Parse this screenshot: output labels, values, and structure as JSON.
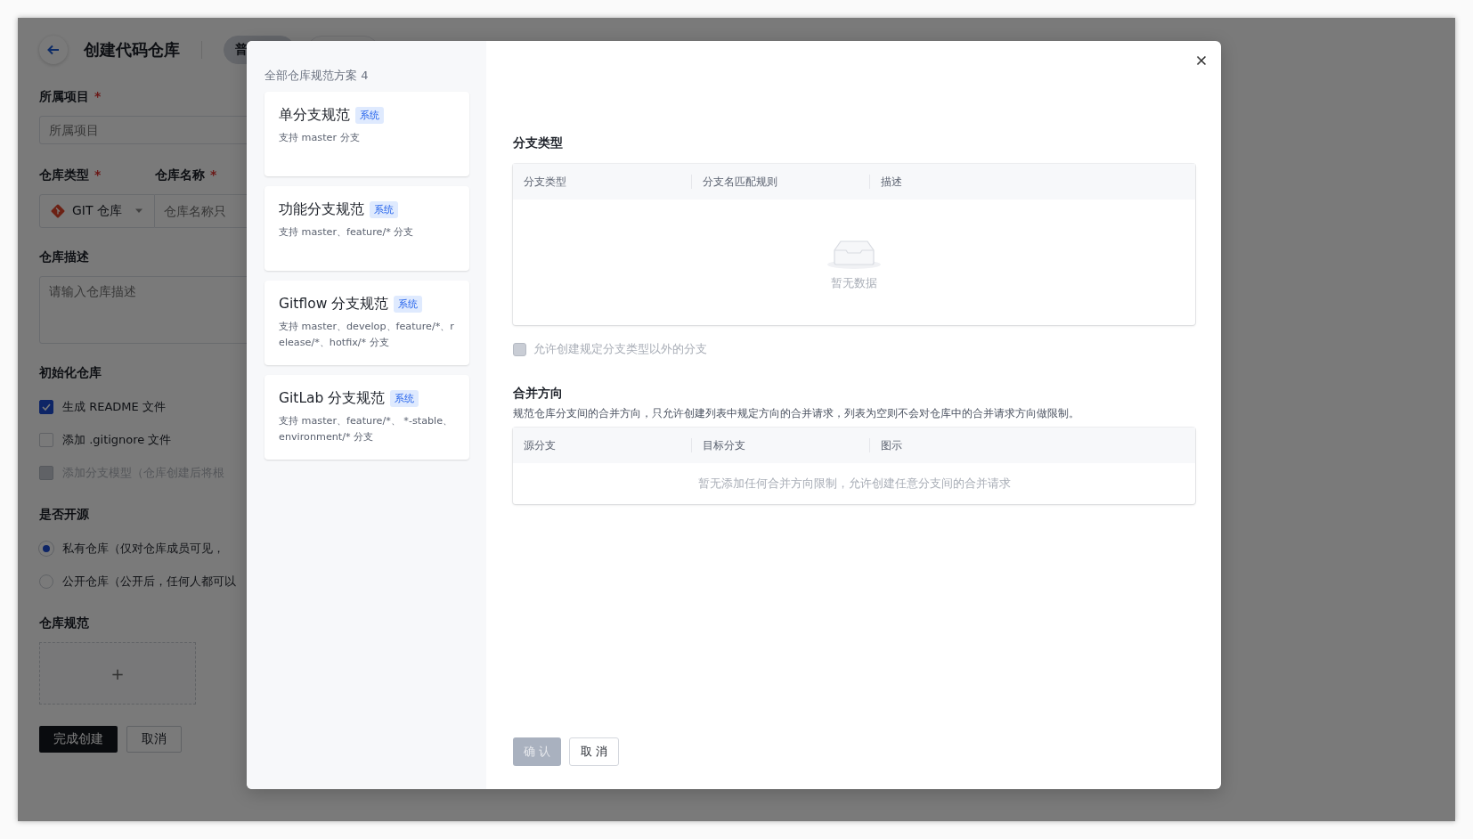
{
  "background_page": {
    "title": "创建代码仓库",
    "tabs": [
      {
        "label": "普",
        "selected": true
      },
      {
        "selected": false
      }
    ],
    "project": {
      "label": "所属项目",
      "required_mark": "*",
      "placeholder": "所属项目"
    },
    "repo_type": {
      "label": "仓库类型",
      "required_mark": "*",
      "value": "GIT 仓库"
    },
    "repo_name": {
      "label": "仓库名称",
      "required_mark": "*",
      "placeholder": "仓库名称只"
    },
    "description": {
      "label": "仓库描述",
      "placeholder": "请输入仓库描述"
    },
    "init": {
      "label": "初始化仓库",
      "options": [
        {
          "label": "生成 README 文件",
          "checked": true,
          "disabled": false
        },
        {
          "label": "添加 .gitignore 文件",
          "checked": false,
          "disabled": false
        },
        {
          "label": "添加分支模型（仓库创建后将根",
          "checked": false,
          "disabled": true
        }
      ]
    },
    "visibility": {
      "label": "是否开源",
      "options": [
        {
          "label": "私有仓库（仅对仓库成员可见，",
          "selected": true
        },
        {
          "label": "公开仓库（公开后，任何人都可以",
          "selected": false
        }
      ]
    },
    "spec": {
      "label": "仓库规范",
      "add": "+"
    },
    "buttons": [
      {
        "label": "完成创建",
        "kind": "primary"
      },
      {
        "label": "取消",
        "kind": "default"
      }
    ]
  },
  "modal": {
    "list_title": "全部仓库规范方案 4",
    "schemes": [
      {
        "name": "单分支规范",
        "badge": "系统",
        "description": "支持 master 分支"
      },
      {
        "name": "功能分支规范",
        "badge": "系统",
        "description": "支持 master、feature/* 分支"
      },
      {
        "name": "Gitflow 分支规范",
        "badge": "系统",
        "description": "支持 master、develop、feature/*、release/*、hotfix/* 分支"
      },
      {
        "name": "GitLab 分支规范",
        "badge": "系统",
        "description": "支持 master、feature/*、 *-stable、environment/* 分支"
      }
    ],
    "branch_types": {
      "title": "分支类型",
      "columns": [
        "分支类型",
        "分支名匹配规则",
        "描述"
      ],
      "empty_text": "暂无数据"
    },
    "allow_other": {
      "label": "允许创建规定分支类型以外的分支",
      "checked": false,
      "disabled": true
    },
    "merge": {
      "title": "合并方向",
      "description": "规范仓库分支间的合并方向，只允许创建列表中规定方向的合并请求，列表为空则不会对仓库中的合并请求方向做限制。",
      "columns": [
        "源分支",
        "目标分支",
        "图示"
      ],
      "empty_text": "暂无添加任何合并方向限制，允许创建任意分支间的合并请求"
    },
    "buttons": [
      {
        "label": "确 认",
        "kind": "primary",
        "disabled": true
      },
      {
        "label": "取 消",
        "kind": "default",
        "disabled": false
      }
    ]
  }
}
